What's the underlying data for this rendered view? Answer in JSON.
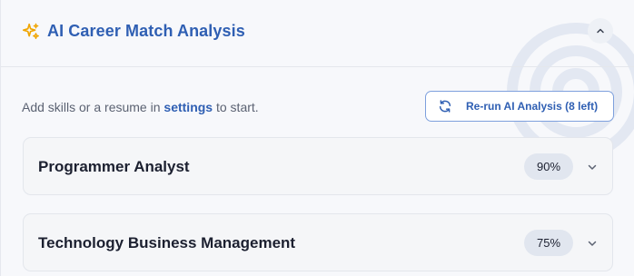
{
  "header": {
    "title": "AI Career Match Analysis",
    "icon": "sparkles-icon",
    "accent_color": "#2f5fb3",
    "icon_color": "#f0a500"
  },
  "hint": {
    "prefix": "Add skills or a resume in",
    "link": "settings",
    "suffix": "to start."
  },
  "rerun_button": {
    "label": "Re-run AI Analysis (8 left)",
    "icon": "refresh-icon"
  },
  "matches": [
    {
      "title": "Programmer Analyst",
      "score": "90%"
    },
    {
      "title": "Technology Business Management",
      "score": "75%"
    }
  ]
}
